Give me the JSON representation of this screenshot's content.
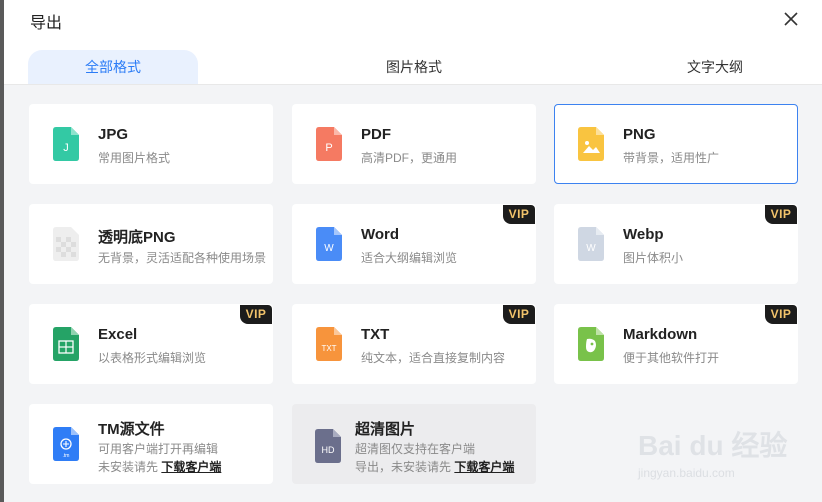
{
  "dialog": {
    "title": "导出"
  },
  "tabs": [
    {
      "label": "全部格式",
      "active": true
    },
    {
      "label": "图片格式",
      "active": false
    },
    {
      "label": "文字大纲",
      "active": false
    }
  ],
  "formats": [
    {
      "name": "JPG",
      "desc": "常用图片格式",
      "icon": "jpg-file-icon",
      "color": "#33c9a4",
      "glyph": "J",
      "vip": false
    },
    {
      "name": "PDF",
      "desc": "高清PDF，更通用",
      "icon": "pdf-file-icon",
      "color": "#f57a62",
      "glyph": "P",
      "vip": false
    },
    {
      "name": "PNG",
      "desc": "带背景，适用性广",
      "icon": "png-file-icon",
      "color": "#f9c440",
      "glyph": "",
      "vip": false,
      "selected": true
    },
    {
      "name": "透明底PNG",
      "desc": "无背景，灵活适配各种使用场景",
      "icon": "transparent-png-file-icon",
      "color": "#e6e6e6",
      "glyph": "",
      "vip": false
    },
    {
      "name": "Word",
      "desc": "适合大纲编辑浏览",
      "icon": "word-file-icon",
      "color": "#4a8cf7",
      "glyph": "W",
      "vip": true
    },
    {
      "name": "Webp",
      "desc": "图片体积小",
      "icon": "webp-file-icon",
      "color": "#cfd7e3",
      "glyph": "W",
      "vip": true
    },
    {
      "name": "Excel",
      "desc": "以表格形式编辑浏览",
      "icon": "excel-file-icon",
      "color": "#25a366",
      "glyph": "X",
      "vip": true
    },
    {
      "name": "TXT",
      "desc": "纯文本，适合直接复制内容",
      "icon": "txt-file-icon",
      "color": "#f7943c",
      "glyph": "TXT",
      "vip": true
    },
    {
      "name": "Markdown",
      "desc": "便于其他软件打开",
      "icon": "markdown-file-icon",
      "color": "#79c24a",
      "glyph": "",
      "vip": true
    },
    {
      "name": "TM源文件",
      "desc": "可用客户端打开再编辑",
      "desc2_prefix": "未安装请先 ",
      "desc2_link": "下载客户端",
      "icon": "tm-source-file-icon",
      "color": "#2f7df6",
      "glyph": ".tm",
      "vip": false
    },
    {
      "name": "超清图片",
      "desc": "超清图仅支持在客户端",
      "desc2_prefix": "导出，未安装请先 ",
      "desc2_link": "下载客户端",
      "icon": "hd-image-file-icon",
      "color": "#6b6f8c",
      "glyph": "HD",
      "vip": false,
      "disabled": true
    }
  ],
  "badge": {
    "vip": "VIP"
  },
  "watermark": {
    "line1": "Bai du 经验",
    "line2": "jingyan.baidu.com"
  }
}
